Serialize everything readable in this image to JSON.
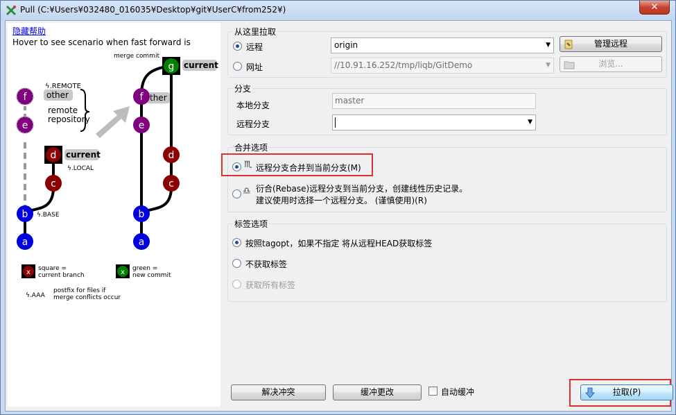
{
  "window": {
    "title": "Pull (C:¥Users¥032480_016035¥Desktop¥git¥UserC¥from252¥)",
    "close_label": "✕"
  },
  "help": {
    "hide_help": "隐藏帮助",
    "hover_text": "Hover to see scenario when fast forward is",
    "diagram": {
      "merge_commit": "merge commit",
      "remote_marker": "ϟ.REMOTE",
      "local_marker": "ϟ.LOCAL",
      "base_marker": "ϟ.BASE",
      "other": "other",
      "other_right": "ther",
      "current": "current",
      "remote_repository_1": "remote",
      "remote_repository_2": "repository",
      "nodes_left": [
        "f",
        "e",
        "d",
        "c",
        "b",
        "a"
      ],
      "nodes_right": [
        "g",
        "f",
        "e",
        "d",
        "c",
        "b",
        "a"
      ],
      "legend_square_node": "x",
      "legend_square_1": "square =",
      "legend_square_2": "current branch",
      "legend_green_node": "x",
      "legend_green_1": "green =",
      "legend_green_2": "new commit",
      "legend_aaa": "ϟ.AAA",
      "legend_postfix_1": "postfix for files if",
      "legend_postfix_2": "merge conflicts occur"
    }
  },
  "pull_from": {
    "title": "从这里拉取",
    "remote_label": "远程",
    "remote_value": "origin",
    "manage_remotes": "管理远程",
    "url_label": "网址",
    "url_value": "//10.91.16.252/tmp/liqb/GitDemo",
    "browse": "浏览..."
  },
  "branch": {
    "title": "分支",
    "local_label": "本地分支",
    "local_value": "master",
    "remote_label": "远程分支",
    "remote_value": ""
  },
  "merge_options": {
    "title": "合并选项",
    "merge_label": "远程分支合并到当前分支(M)",
    "rebase_line1": "衍合(Rebase)远程分支到当前分支，创建线性历史记录。",
    "rebase_line2": "建议使用时选择一个远程分支。 (谨慎使用)(R)"
  },
  "tag_options": {
    "title": "标签选项",
    "opt1": "按照tagopt，如果不指定 将从远程HEAD获取标签",
    "opt2": "不获取标签",
    "opt3": "获取所有标签"
  },
  "footer": {
    "resolve": "解决冲突",
    "stash": "缓冲更改",
    "autostash": "自动缓冲",
    "pull": "拉取(P)"
  },
  "colors": {
    "purple": "#800080",
    "darkred": "#8b0000",
    "blue": "#0000e0",
    "green": "#008000",
    "highlight": "#d83333"
  }
}
